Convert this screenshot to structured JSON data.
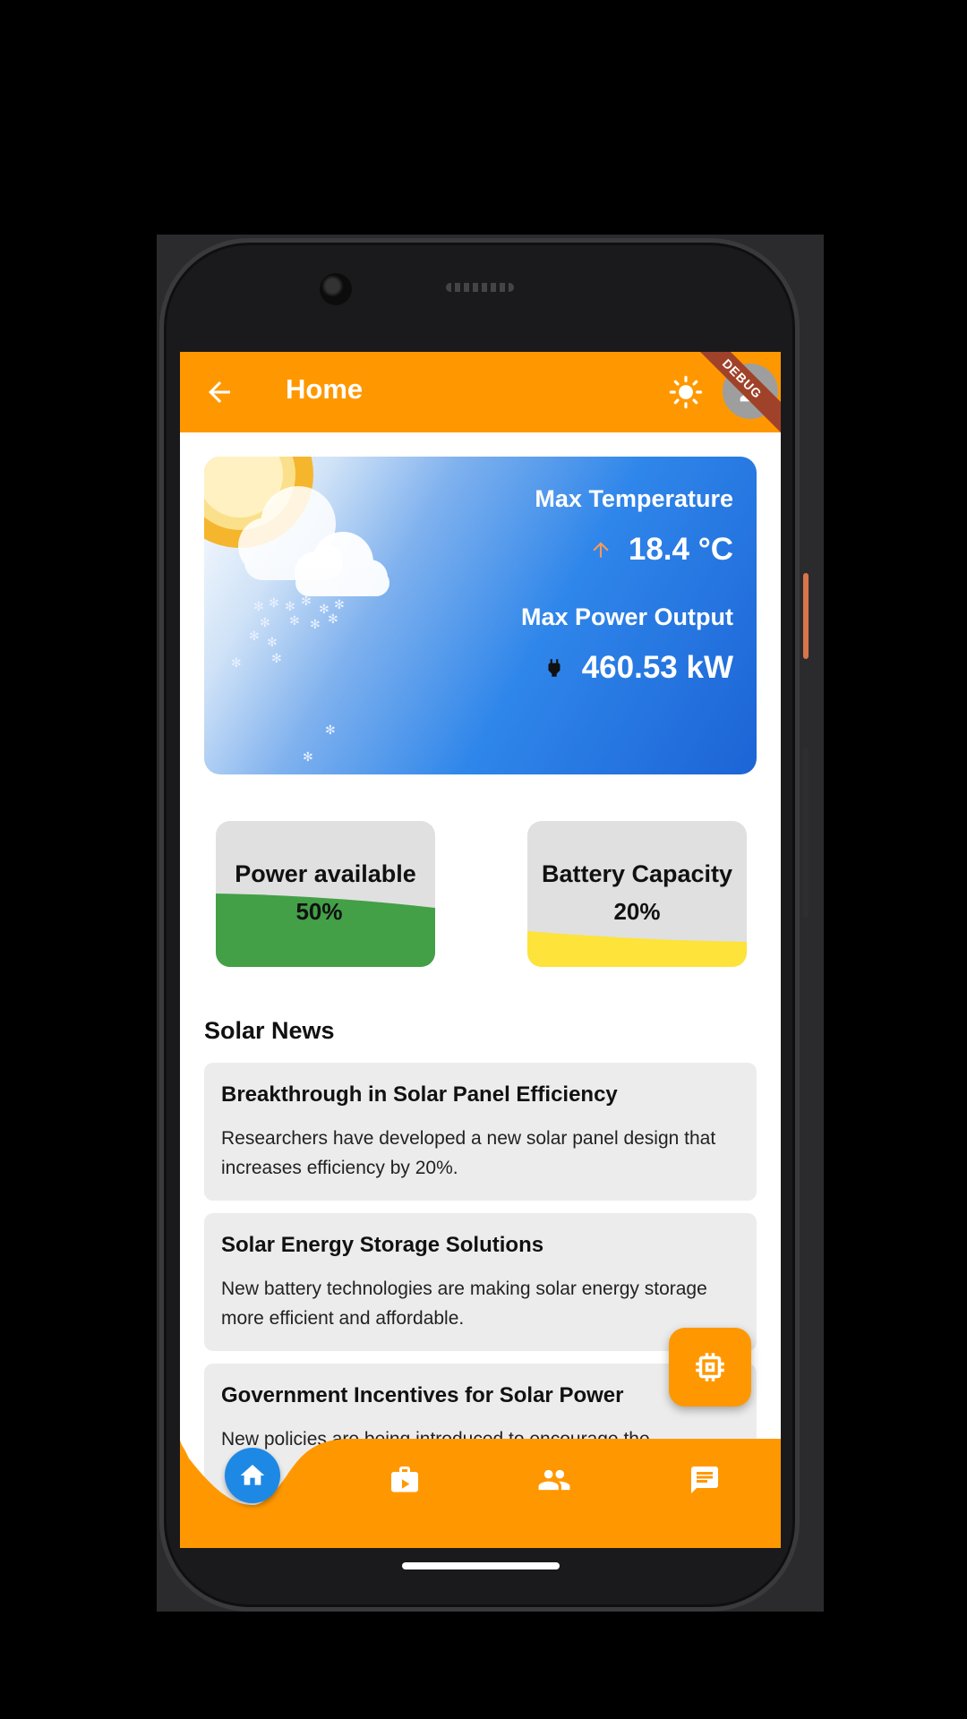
{
  "appbar": {
    "title": "Home",
    "debug_label": "DEBUG"
  },
  "weather": {
    "temp_label": "Max Temperature",
    "temp_value": "18.4 °C",
    "power_label": "Max Power Output",
    "power_value": "460.53 kW"
  },
  "gauges": [
    {
      "label": "Power available",
      "value_text": "50%",
      "level": 0.5,
      "color": "#43a047"
    },
    {
      "label": "Battery Capacity",
      "value_text": "20%",
      "level": 0.2,
      "color": "#fde33a"
    }
  ],
  "news": {
    "heading": "Solar News",
    "items": [
      {
        "title": "Breakthrough in Solar Panel Efficiency",
        "body": "Researchers have developed a new solar panel design that increases efficiency by 20%."
      },
      {
        "title": "Solar Energy Storage Solutions",
        "body": "New battery technologies are making solar energy storage more efficient and affordable."
      },
      {
        "title": "Government Incentives for Solar Power",
        "body": "New policies are being introduced to encourage the"
      }
    ]
  },
  "bottom_nav": {
    "items": [
      "home-icon",
      "work-icon",
      "people-icon",
      "chat-icon"
    ],
    "active": "home-icon"
  },
  "colors": {
    "accent": "#ff9800",
    "active_nav": "#1e88e5",
    "card_bg": "#ececec"
  }
}
